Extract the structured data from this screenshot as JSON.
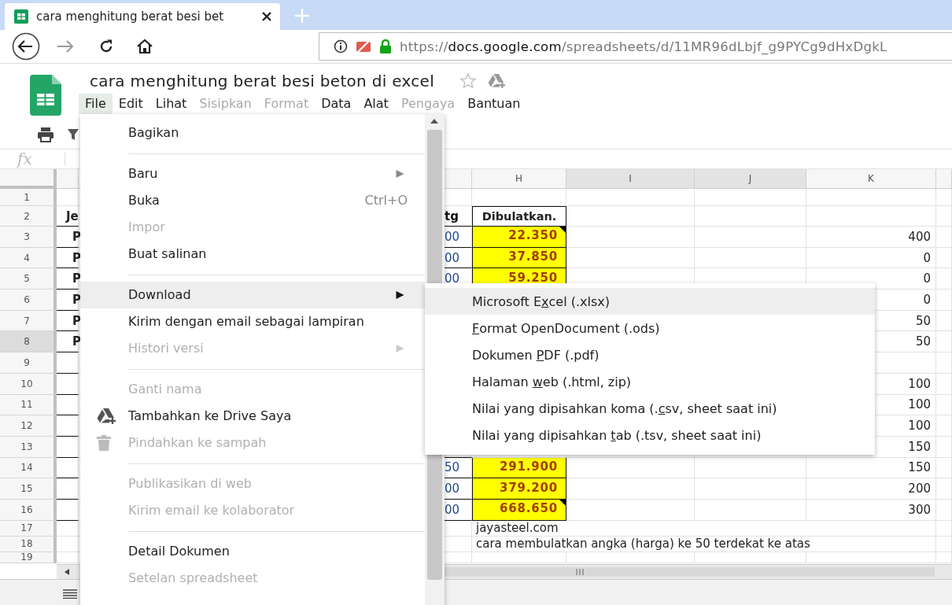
{
  "browser": {
    "tab": {
      "title": "cara menghitung berat besi bet",
      "selected": true
    },
    "url": {
      "scheme": "https://",
      "host": "docs.google.com",
      "path": "/spreadsheets/d/11MR96dLbjf_g9PYCg9dHxDgkL"
    }
  },
  "document": {
    "title": "cara menghitung berat besi beton di excel",
    "starred": false
  },
  "menubar": [
    {
      "label": "File",
      "selected": true,
      "disabled": false
    },
    {
      "label": "Edit",
      "selected": false,
      "disabled": false
    },
    {
      "label": "Lihat",
      "selected": false,
      "disabled": false
    },
    {
      "label": "Sisipkan",
      "selected": false,
      "disabled": true
    },
    {
      "label": "Format",
      "selected": false,
      "disabled": true
    },
    {
      "label": "Data",
      "selected": false,
      "disabled": false
    },
    {
      "label": "Alat",
      "selected": false,
      "disabled": false
    },
    {
      "label": "Pengaya",
      "selected": false,
      "disabled": true
    },
    {
      "label": "Bantuan",
      "selected": false,
      "disabled": false
    }
  ],
  "formula_bar": {
    "label": "fx"
  },
  "sheet": {
    "columns": [
      {
        "label": "H",
        "highlighted": false
      },
      {
        "label": "I",
        "highlighted": true
      },
      {
        "label": "J",
        "highlighted": true
      },
      {
        "label": "K",
        "highlighted": false
      }
    ],
    "rows": [
      {
        "number": "1",
        "highlighted": false,
        "bordered": false
      },
      {
        "number": "2",
        "highlighted": false,
        "bordered": true,
        "a": "Je",
        "g": "tg",
        "h": {
          "kind": "header",
          "text": "Dibulatkan."
        }
      },
      {
        "number": "3",
        "highlighted": false,
        "bordered": true,
        "a": "P",
        "g": "00",
        "h": {
          "kind": "value",
          "text": "22.350",
          "note": true
        },
        "k": "400"
      },
      {
        "number": "4",
        "highlighted": false,
        "bordered": true,
        "a": "P",
        "g": "00",
        "h": {
          "kind": "value",
          "text": "37.850",
          "note": false
        },
        "k": "0"
      },
      {
        "number": "5",
        "highlighted": false,
        "bordered": true,
        "a": "P",
        "g": "00",
        "h": {
          "kind": "value",
          "text": "59.250",
          "note": false
        },
        "k": "0"
      },
      {
        "number": "6",
        "highlighted": false,
        "bordered": true,
        "a": "P",
        "k": "0"
      },
      {
        "number": "7",
        "highlighted": false,
        "bordered": true,
        "a": "P",
        "k": "50"
      },
      {
        "number": "8",
        "highlighted": true,
        "bordered": true,
        "a": "P",
        "k": "50"
      },
      {
        "number": "9",
        "highlighted": false,
        "bordered": true
      },
      {
        "number": "10",
        "highlighted": false,
        "bordered": true,
        "k": "100"
      },
      {
        "number": "11",
        "highlighted": false,
        "bordered": true,
        "k": "100"
      },
      {
        "number": "12",
        "highlighted": false,
        "bordered": true,
        "k": "100"
      },
      {
        "number": "13",
        "highlighted": false,
        "bordered": true,
        "k": "150"
      },
      {
        "number": "14",
        "highlighted": false,
        "bordered": true,
        "g": "50",
        "h": {
          "kind": "value",
          "text": "291.900",
          "note": false
        },
        "k": "150"
      },
      {
        "number": "15",
        "highlighted": false,
        "bordered": true,
        "g": "00",
        "h": {
          "kind": "value",
          "text": "379.200",
          "note": false
        },
        "k": "200"
      },
      {
        "number": "16",
        "highlighted": false,
        "bordered": true,
        "g": "00",
        "h": {
          "kind": "value",
          "text": "668.650",
          "note": true
        },
        "k": "300"
      },
      {
        "number": "17",
        "highlighted": false,
        "bordered": false,
        "h": {
          "kind": "text",
          "text": "jayasteel.com"
        }
      },
      {
        "number": "18",
        "highlighted": false,
        "bordered": false,
        "h": {
          "kind": "text",
          "text": "cara membulatkan angka (harga) ke 50 terdekat ke atas"
        }
      },
      {
        "number": "19",
        "highlighted": false,
        "bordered": false
      }
    ]
  },
  "file_menu": [
    {
      "kind": "item",
      "label": "Bagikan",
      "disabled": false,
      "selected": false,
      "submenu": false
    },
    {
      "kind": "separator"
    },
    {
      "kind": "item",
      "label": "Baru",
      "disabled": false,
      "selected": false,
      "submenu": true
    },
    {
      "kind": "item",
      "label": "Buka",
      "disabled": false,
      "selected": false,
      "submenu": false,
      "shortcut": "Ctrl+O"
    },
    {
      "kind": "item",
      "label": "Impor",
      "disabled": true,
      "selected": false,
      "submenu": false
    },
    {
      "kind": "item",
      "label": "Buat salinan",
      "disabled": false,
      "selected": false,
      "submenu": false
    },
    {
      "kind": "separator"
    },
    {
      "kind": "item",
      "label": "Download",
      "disabled": false,
      "selected": true,
      "submenu": true
    },
    {
      "kind": "item",
      "label": "Kirim dengan email sebagai lampiran",
      "disabled": false,
      "selected": false,
      "submenu": false
    },
    {
      "kind": "item",
      "label": "Histori versi",
      "disabled": true,
      "selected": false,
      "submenu": true
    },
    {
      "kind": "separator"
    },
    {
      "kind": "item",
      "label": "Ganti nama",
      "disabled": true,
      "selected": false,
      "submenu": false
    },
    {
      "kind": "drive",
      "label": "Tambahkan ke Drive Saya",
      "disabled": false,
      "selected": false,
      "submenu": false
    },
    {
      "kind": "trash",
      "label": "Pindahkan ke sampah",
      "disabled": true,
      "selected": false,
      "submenu": false
    },
    {
      "kind": "separator"
    },
    {
      "kind": "item",
      "label": "Publikasikan di web",
      "disabled": true,
      "selected": false,
      "submenu": false
    },
    {
      "kind": "item",
      "label": "Kirim email ke kolaborator",
      "disabled": true,
      "selected": false,
      "submenu": false
    },
    {
      "kind": "separator"
    },
    {
      "kind": "item",
      "label": "Detail Dokumen",
      "disabled": false,
      "selected": false,
      "submenu": false
    },
    {
      "kind": "item",
      "label": "Setelan spreadsheet",
      "disabled": true,
      "selected": false,
      "submenu": false
    }
  ],
  "download_submenu": [
    {
      "before": "Microsoft E",
      "key": "x",
      "after": "cel (.xlsx)",
      "selected": true
    },
    {
      "key": "F",
      "after": "ormat OpenDocument (.ods)",
      "selected": false
    },
    {
      "before": "Dokumen ",
      "key": "P",
      "after": "DF (.pdf)",
      "selected": false
    },
    {
      "before": "Halaman ",
      "key": "w",
      "after": "eb (.html, zip)",
      "selected": false
    },
    {
      "before": "Nilai yang dipisahkan koma (.",
      "key": "c",
      "after": "sv, sheet saat ini)",
      "selected": false
    },
    {
      "before": "Nilai yang dipisahkan ",
      "key": "t",
      "after": "ab (.tsv, sheet saat ini)",
      "selected": false
    }
  ]
}
